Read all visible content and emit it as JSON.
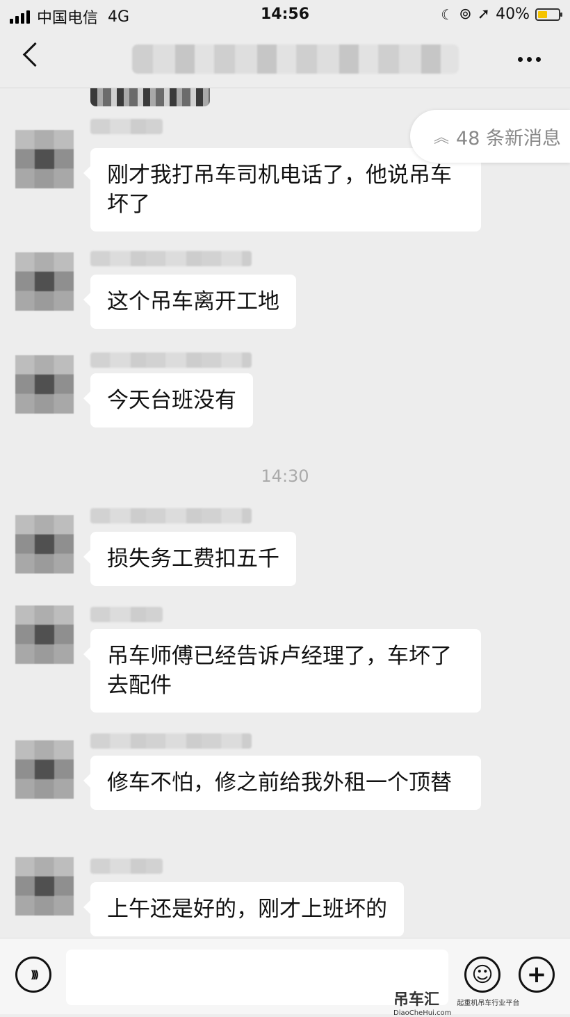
{
  "status_bar": {
    "carrier": "中国电信",
    "network": "4G",
    "time": "14:56",
    "battery": "40%"
  },
  "nav": {
    "title": ""
  },
  "new_messages": {
    "label": "48 条新消息"
  },
  "messages": [
    {
      "text": "刚才我打吊车司机电话了，他说吊车坏了"
    },
    {
      "text": "这个吊车离开工地"
    },
    {
      "text": "今天台班没有"
    },
    {
      "text": "损失务工费扣五千"
    },
    {
      "text": "吊车师傅已经告诉卢经理了，车坏了去配件"
    },
    {
      "text": "修车不怕，修之前给我外租一个顶替"
    },
    {
      "text": "上午还是好的，刚才上班坏的"
    }
  ],
  "timestamp": "14:30",
  "input": {
    "placeholder": ""
  },
  "watermark": {
    "logo": "吊车汇",
    "domain": "DiaoCheHui.com",
    "slogan": "起重机吊车行业平台"
  },
  "icons": {
    "back": "back-chevron-icon",
    "more": "more-dots-icon",
    "voice": "voice-icon",
    "emoji": "emoji-icon",
    "plus": "plus-icon",
    "pill": "double-chevron-up-icon"
  }
}
